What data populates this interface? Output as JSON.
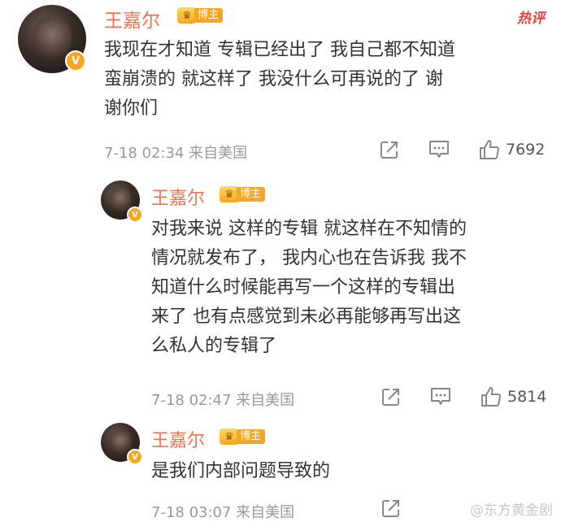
{
  "hot_label": "热评",
  "comments": [
    {
      "user": "王嘉尔",
      "badge": "博主",
      "text_lines": [
        "我现在才知道 专辑已经出了 我自己都不知道",
        "蛮崩溃的  就这样了 我没什么可再说的了  谢",
        "谢你们"
      ],
      "meta": "7-18 02:34  来自美国",
      "likes": "7692"
    },
    {
      "user": "王嘉尔",
      "badge": "博主",
      "text_lines": [
        "对我来说 这样的专辑 就这样在不知情的",
        "情况就发布了， 我内心也在告诉我 我不",
        "知道什么时候能再写一个这样的专辑出",
        "来了 也有点感觉到未必再能够再写出这",
        "么私人的专辑了"
      ],
      "meta": "7-18 02:47  来自美国",
      "likes": "5814"
    },
    {
      "user": "王嘉尔",
      "badge": "博主",
      "text_lines": [
        "是我们内部问题导致的"
      ],
      "meta": "7-18 03:07  来自美国",
      "likes": ""
    }
  ],
  "watermark": "@东方黄金剧",
  "icons": {
    "crown": "crown-icon",
    "share": "share-icon",
    "comment": "comment-icon",
    "like": "thumbs-up-icon",
    "verified": "verified-v-icon"
  },
  "colors": {
    "username": "#eb7350",
    "badge": "#f5a623",
    "hot": "#e0453a"
  }
}
